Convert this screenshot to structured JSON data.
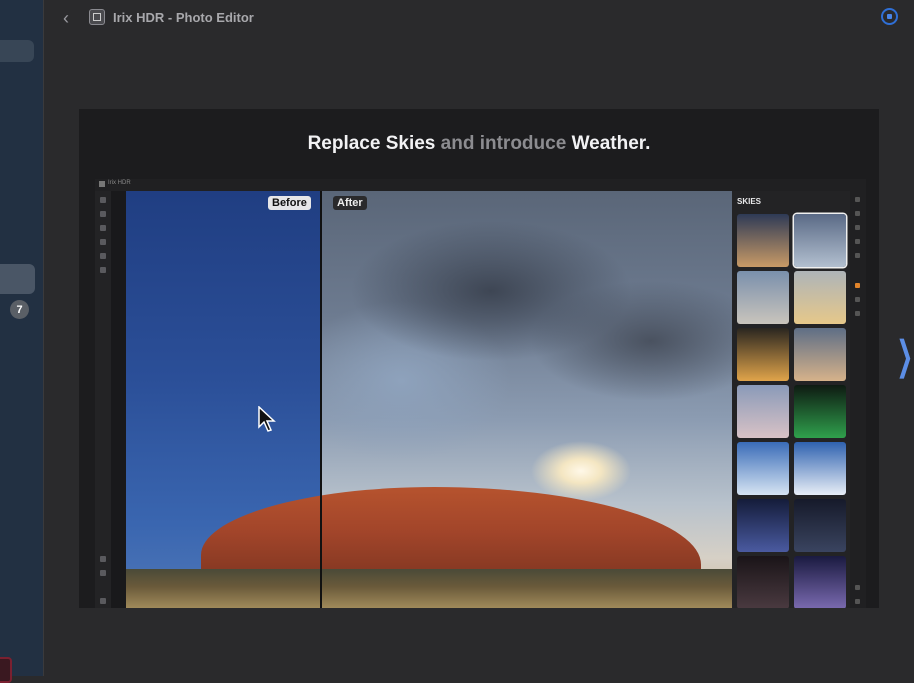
{
  "window": {
    "title": "Irix HDR - Photo Editor"
  },
  "sidebar": {
    "badge_count": "7"
  },
  "slide": {
    "headline": {
      "part1": "Replace Skies",
      "part2": " and introduce ",
      "part3": "Weather."
    },
    "editor": {
      "app_name": "Irix HDR",
      "before_label": "Before",
      "after_label": "After",
      "panel_title": "SKIES",
      "thumbnails": [
        {
          "name": "sky-dusk-clouds",
          "selected": false,
          "colors": [
            "#2e3a56",
            "#c89a66"
          ]
        },
        {
          "name": "sky-overcast-blue",
          "selected": true,
          "colors": [
            "#5a6a86",
            "#b2bfcf"
          ]
        },
        {
          "name": "sky-light-clouds",
          "selected": false,
          "colors": [
            "#7a90ac",
            "#c9c4bc"
          ]
        },
        {
          "name": "sky-golden-haze",
          "selected": false,
          "colors": [
            "#aeb4b8",
            "#e6c88a"
          ]
        },
        {
          "name": "sky-sunset-gold",
          "selected": false,
          "colors": [
            "#2a2620",
            "#e0a44a"
          ]
        },
        {
          "name": "sky-evening-clouds",
          "selected": false,
          "colors": [
            "#5e6e86",
            "#d6b28a"
          ]
        },
        {
          "name": "sky-pastel-dusk",
          "selected": false,
          "colors": [
            "#8a9ab8",
            "#d8c2c6"
          ]
        },
        {
          "name": "sky-aurora",
          "selected": false,
          "colors": [
            "#0e1a12",
            "#2fa04c"
          ]
        },
        {
          "name": "sky-blue-cumulus",
          "selected": false,
          "colors": [
            "#3a6cb8",
            "#d6e4f2"
          ]
        },
        {
          "name": "sky-bright-cumulus",
          "selected": false,
          "colors": [
            "#2f62b0",
            "#e8eef6"
          ]
        },
        {
          "name": "sky-milky-way-blue",
          "selected": false,
          "colors": [
            "#141c3a",
            "#4a5aa0"
          ]
        },
        {
          "name": "sky-night-stars",
          "selected": false,
          "colors": [
            "#161a2a",
            "#3a4460"
          ]
        },
        {
          "name": "sky-dark-nebula",
          "selected": false,
          "colors": [
            "#1a1418",
            "#4a3a40"
          ]
        },
        {
          "name": "sky-milky-way-purple",
          "selected": false,
          "colors": [
            "#1a1a40",
            "#7a6ab0"
          ]
        }
      ]
    }
  },
  "colors": {
    "accent": "#2f6fd6",
    "arrow": "#5c8ee6",
    "active_tool": "#e0832a"
  }
}
